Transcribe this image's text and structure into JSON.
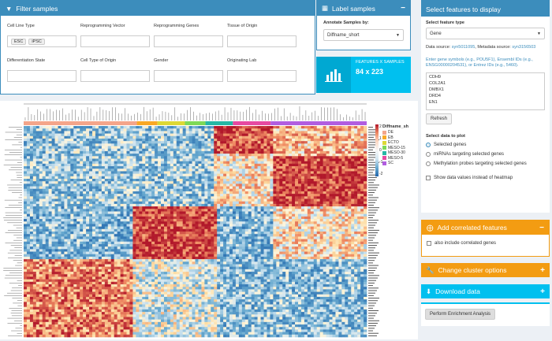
{
  "filter": {
    "title": "Filter samples",
    "fields": [
      {
        "label": "Cell Line Type",
        "chips": [
          "ESC",
          "iPSC"
        ]
      },
      {
        "label": "Reprogramming Vector",
        "chips": []
      },
      {
        "label": "Reprogramming Genes",
        "chips": []
      },
      {
        "label": "Tissue of Origin",
        "chips": []
      },
      {
        "label": "Differentiation State",
        "chips": []
      },
      {
        "label": "Cell Type of Origin",
        "chips": []
      },
      {
        "label": "Gender",
        "chips": []
      },
      {
        "label": "Originating Lab",
        "chips": []
      }
    ]
  },
  "label_samples": {
    "title": "Label samples",
    "annotate_label": "Annotate Samples by:",
    "annotate_value": "Diffname_short"
  },
  "stats": {
    "title": "FEATURES X SAMPLES",
    "value": "84 x 223"
  },
  "right": {
    "header": "Select features to display",
    "feature_type_label": "Select feature type",
    "feature_type_value": "Gene",
    "data_source_label": "Data source:",
    "data_source_link": "syn5011095",
    "metadata_label": ", Metadata source:",
    "metadata_link": "syn3156503",
    "hint": "Enter gene symbols (e.g., POU5F1), Ensembl IDs (e.g., ENSG00000204531), or Entrez IDs (e.g., 5460).",
    "genes": [
      "CDH9",
      "COL2A1",
      "DMBX1",
      "DRD4",
      "EN1"
    ],
    "refresh_label": "Refresh",
    "plot_label": "Select data to plot",
    "plot_options": [
      "Selected genes",
      "miRNAs targeting selected genes",
      "Methylation probes targeting selected genes"
    ],
    "show_values_label": "Show data values instead of heatmap",
    "correlated_title": "Add correlated features",
    "correlated_check": "also include correlated genes",
    "cluster_title": "Change cluster options",
    "download_title": "Download data",
    "enrich_label": "Perform Enrichment Analysis",
    "tools_minus": "−",
    "tools_plus": "+"
  },
  "legend": {
    "title": "Diffname_sh",
    "scale": [
      "2",
      "1",
      "0",
      "-1",
      "-2"
    ],
    "items": [
      {
        "label": "DE",
        "color": "#f4a58a"
      },
      {
        "label": "EB",
        "color": "#f9a825"
      },
      {
        "label": "ECTO",
        "color": "#ddd835"
      },
      {
        "label": "MESO-15",
        "color": "#7ed957"
      },
      {
        "label": "MESO-30",
        "color": "#26b8a5"
      },
      {
        "label": "MESO-5",
        "color": "#e64aa1"
      },
      {
        "label": "SC",
        "color": "#b15de0"
      }
    ],
    "segments": [
      "DE",
      "EB",
      "ECTO",
      "MESO-15",
      "MESO-30",
      "MESO-5",
      "SC"
    ],
    "segment_fractions": [
      0.33,
      0.06,
      0.08,
      0.06,
      0.08,
      0.11,
      0.28
    ]
  },
  "heatmap": {
    "rows": 84,
    "cols": 223
  },
  "colors": {
    "header_blue": "#3c8dbc",
    "info_blue": "#00c0ef",
    "orange": "#f39c12"
  }
}
